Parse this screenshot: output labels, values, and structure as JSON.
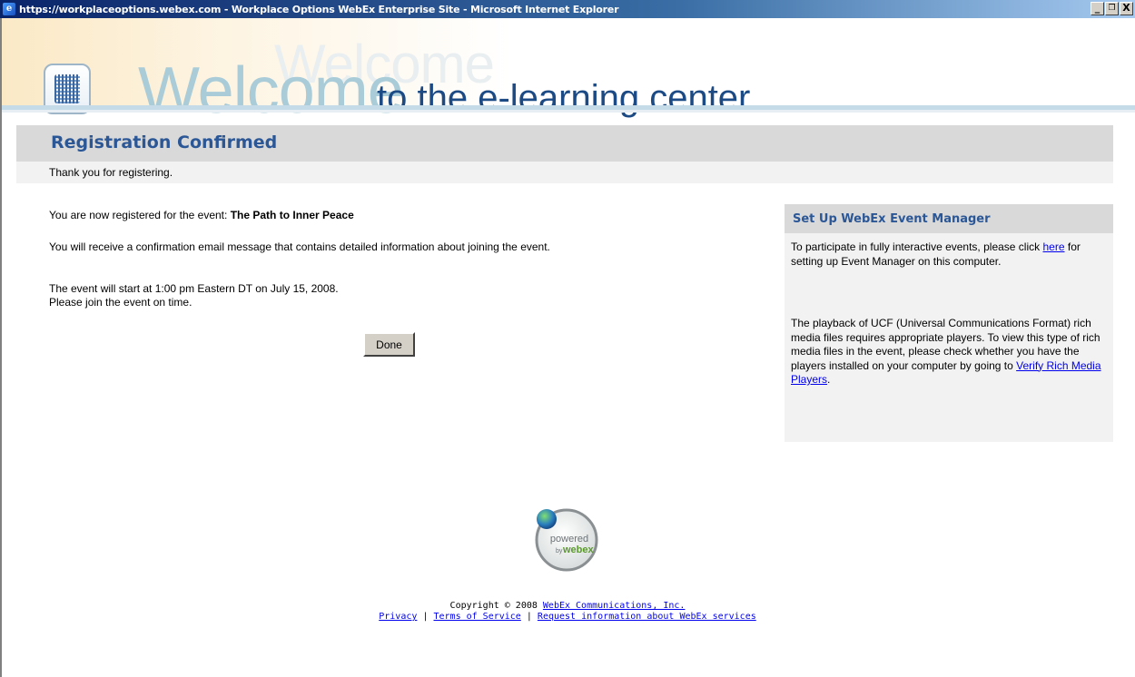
{
  "window": {
    "title": "https://workplaceoptions.webex.com - Workplace Options WebEx Enterprise Site - Microsoft Internet Explorer",
    "minimize_glyph": "_",
    "restore_glyph": "ə",
    "close_glyph": "X"
  },
  "banner": {
    "welcome": "Welcome",
    "ghost_text": "Welcome",
    "subtitle": "to the e-learning center"
  },
  "registration": {
    "title": "Registration Confirmed",
    "thanks": "Thank you for registering.",
    "registered_prefix": "You are now registered for the event:",
    "event_name": "The Path to Inner Peace",
    "email_notice": "You will receive a confirmation email message that contains detailed information about joining the event.",
    "start_time": "The event will start at 1:00 pm Eastern DT on July 15, 2008.",
    "join_notice": "Please join the event on time.",
    "done_label": "Done"
  },
  "side_panel": {
    "title": "Set Up WebEx Event Manager",
    "para1_before": "To participate in fully interactive events, please click",
    "para1_link": "here",
    "para1_after": "for setting up Event Manager on this computer.",
    "para2_before": "The playback of UCF (Universal Communications Format) rich media files requires appropriate players. To view this type of rich media files in the event, please check whether you have the players installed on your computer by going to",
    "para2_link": "Verify Rich Media Players",
    "para2_after": "."
  },
  "footer": {
    "powered_line1": "powered",
    "powered_line2_by": "by",
    "powered_line2_brand": "webex",
    "copyright": "Copyright © 2008",
    "copyright_link": "WebEx Communications, Inc.",
    "privacy": "Privacy",
    "terms": "Terms of Service",
    "request": "Request information about WebEx services",
    "separator": "|"
  },
  "colors": {
    "heading_blue": "#2b5797",
    "welcome_light": "#a9ccd8",
    "subtitle_navy": "#1c4a84",
    "panel_gray": "#f2f2f2",
    "header_gray": "#d9d9d9"
  }
}
